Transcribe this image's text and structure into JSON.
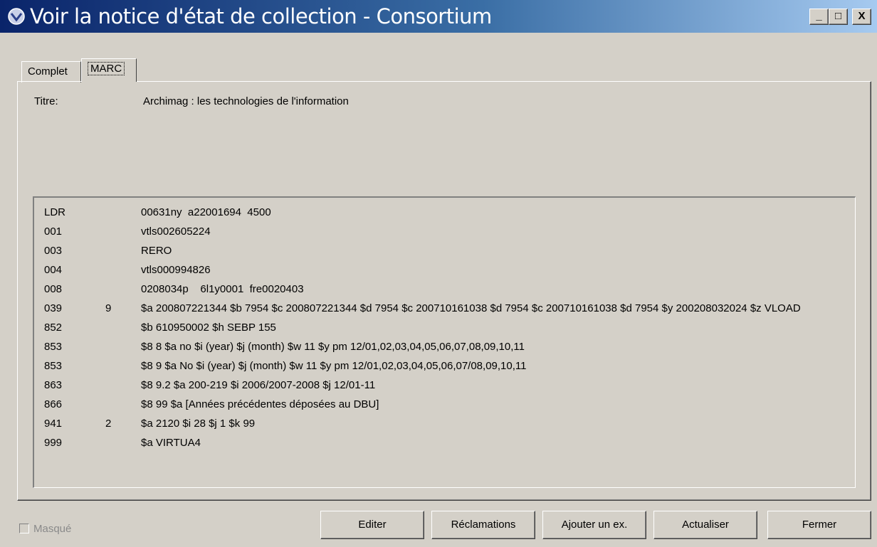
{
  "window": {
    "title": "Voir la notice d'état de collection - Consortium",
    "controls": {
      "minimize": "_",
      "maximize": "□",
      "close": "X"
    }
  },
  "tabs": [
    {
      "label": "Complet",
      "active": false
    },
    {
      "label": "MARC",
      "active": true
    }
  ],
  "record": {
    "title_label": "Titre:",
    "title_value": "Archimag : les technologies de l'information"
  },
  "marc_fields": [
    {
      "tag": "LDR",
      "ind": "",
      "value": "00631ny  a22001694  4500"
    },
    {
      "tag": "001",
      "ind": "",
      "value": "vtls002605224"
    },
    {
      "tag": "003",
      "ind": "",
      "value": "RERO"
    },
    {
      "tag": "004",
      "ind": "",
      "value": "vtls000994826"
    },
    {
      "tag": "008",
      "ind": "",
      "value": "0208034p    6l1y0001  fre0020403"
    },
    {
      "tag": "039",
      "ind": "9",
      "value": "$a 200807221344 $b 7954 $c 200807221344 $d 7954 $c 200710161038 $d 7954 $c 200710161038 $d 7954 $y 200208032024 $z VLOAD"
    },
    {
      "tag": "852",
      "ind": "",
      "value": "$b 610950002 $h SEBP 155"
    },
    {
      "tag": "853",
      "ind": "",
      "value": "$8 8 $a no $i (year) $j (month) $w 11 $y pm 12/01,02,03,04,05,06,07,08,09,10,11"
    },
    {
      "tag": "853",
      "ind": "",
      "value": "$8 9 $a No $i (year) $j (month) $w 11 $y pm 12/01,02,03,04,05,06,07/08,09,10,11"
    },
    {
      "tag": "863",
      "ind": "",
      "value": "$8 9.2 $a 200-219 $i 2006/2007-2008 $j 12/01-11"
    },
    {
      "tag": "866",
      "ind": "",
      "value": "$8 99 $a [Années précédentes déposées au DBU]"
    },
    {
      "tag": "941",
      "ind": "2",
      "value": "$a 2120 $i 28 $j 1 $k 99"
    },
    {
      "tag": "999",
      "ind": "",
      "value": "$a VIRTUA4"
    }
  ],
  "footer": {
    "masque_label": "Masqué",
    "masque_checked": false,
    "buttons": {
      "editer": "Editer",
      "reclamations": "Réclamations",
      "ajouter": "Ajouter un ex.",
      "actualiser": "Actualiser",
      "fermer": "Fermer"
    }
  }
}
